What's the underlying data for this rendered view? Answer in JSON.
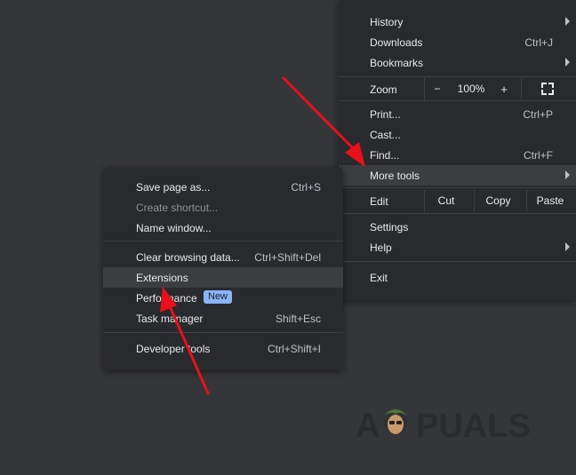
{
  "main_menu": {
    "history": "History",
    "downloads": "Downloads",
    "downloads_shortcut": "Ctrl+J",
    "bookmarks": "Bookmarks",
    "zoom_label": "Zoom",
    "zoom_minus": "−",
    "zoom_value": "100%",
    "zoom_plus": "+",
    "print": "Print...",
    "print_shortcut": "Ctrl+P",
    "cast": "Cast...",
    "find": "Find...",
    "find_shortcut": "Ctrl+F",
    "more_tools": "More tools",
    "edit_label": "Edit",
    "cut": "Cut",
    "copy": "Copy",
    "paste": "Paste",
    "settings": "Settings",
    "help": "Help",
    "exit": "Exit"
  },
  "sub_menu": {
    "save_page": "Save page as...",
    "save_page_shortcut": "Ctrl+S",
    "create_shortcut": "Create shortcut...",
    "name_window": "Name window...",
    "clear_data": "Clear browsing data...",
    "clear_data_shortcut": "Ctrl+Shift+Del",
    "extensions": "Extensions",
    "performance": "Performance",
    "performance_badge": "New",
    "task_manager": "Task manager",
    "task_manager_shortcut": "Shift+Esc",
    "developer_tools": "Developer tools",
    "developer_tools_shortcut": "Ctrl+Shift+I"
  },
  "watermark": {
    "text_a": "A",
    "text_rest": "PUALS"
  },
  "colors": {
    "background": "#35363a",
    "menu": "#292a2d",
    "highlight": "#3c3d41",
    "arrow": "#e8101a",
    "badge": "#8ab4f8"
  }
}
